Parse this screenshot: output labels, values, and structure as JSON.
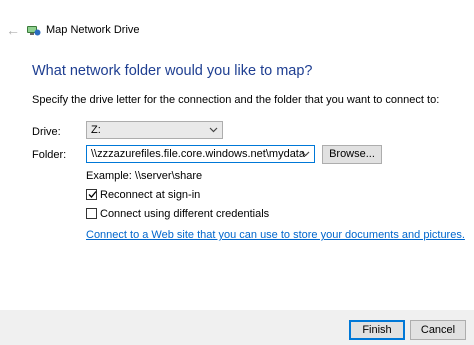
{
  "window": {
    "title": "Map Network Drive",
    "back_icon": "back-arrow-icon",
    "app_icon": "network-drive-icon"
  },
  "main": {
    "heading": "What network folder would you like to map?",
    "instruction": "Specify the drive letter for the connection and the folder that you want to connect to:",
    "drive": {
      "label": "Drive:",
      "value": "Z:"
    },
    "folder": {
      "label": "Folder:",
      "value": "\\\\zzzazurefiles.file.core.windows.net\\mydata"
    },
    "browse_label": "Browse...",
    "example": "Example: \\\\server\\share",
    "reconnect": {
      "label": "Reconnect at sign-in",
      "checked": true
    },
    "credentials": {
      "label": "Connect using different credentials",
      "checked": false
    },
    "link": "Connect to a Web site that you can use to store your documents and pictures."
  },
  "footer": {
    "finish_label": "Finish",
    "cancel_label": "Cancel"
  },
  "colors": {
    "heading": "#1e3e91",
    "link": "#0066cc",
    "accent": "#0078d7",
    "footer_bg": "#f0f0f0"
  }
}
